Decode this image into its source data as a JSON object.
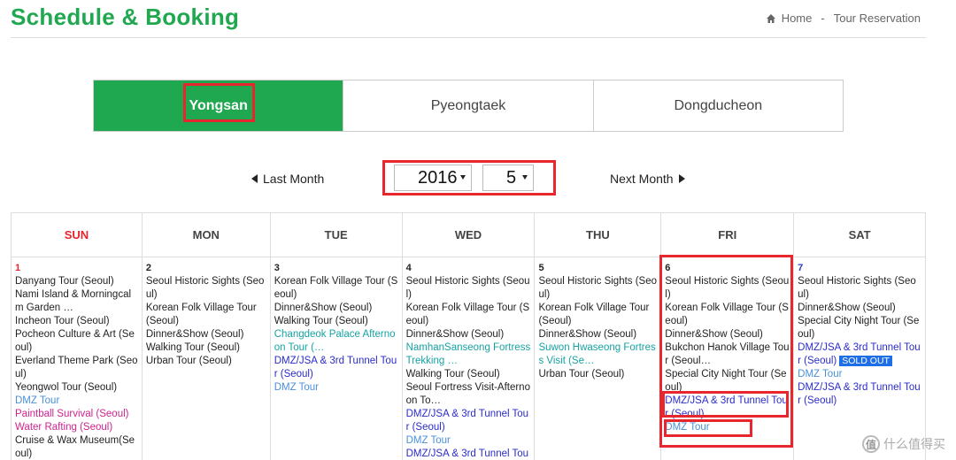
{
  "header": {
    "title": "Schedule & Booking",
    "breadcrumb": {
      "home": "Home",
      "separator": "-",
      "current": "Tour Reservation"
    }
  },
  "locations": [
    {
      "label": "Yongsan",
      "active": true
    },
    {
      "label": "Pyeongtaek",
      "active": false
    },
    {
      "label": "Dongducheon",
      "active": false
    }
  ],
  "month_nav": {
    "prev_label": "Last Month",
    "next_label": "Next Month",
    "year": "2016",
    "month": "5"
  },
  "calendar": {
    "days_of_week": [
      "SUN",
      "MON",
      "TUE",
      "WED",
      "THU",
      "FRI",
      "SAT"
    ],
    "days": [
      {
        "num": "1",
        "tours": [
          {
            "text": "Danyang Tour (Seoul)",
            "color": "black"
          },
          {
            "text": "Nami Island & Morningcalm Garden …",
            "color": "black"
          },
          {
            "text": "Incheon Tour (Seoul)",
            "color": "black"
          },
          {
            "text": "Pocheon Culture & Art (Seoul)",
            "color": "black"
          },
          {
            "text": "Everland Theme Park (Seoul)",
            "color": "black"
          },
          {
            "text": "Yeongwol Tour (Seoul)",
            "color": "black"
          },
          {
            "text": "DMZ Tour",
            "color": "lightblue"
          },
          {
            "text": "Paintball Survival (Seoul)",
            "color": "pink"
          },
          {
            "text": "Water Rafting (Seoul)",
            "color": "pink"
          },
          {
            "text": "Cruise & Wax Museum(Seoul)",
            "color": "black"
          }
        ]
      },
      {
        "num": "2",
        "tours": [
          {
            "text": "Seoul Historic Sights (Seoul)",
            "color": "black"
          },
          {
            "text": "Korean Folk Village Tour (Seoul)",
            "color": "black"
          },
          {
            "text": "Dinner&Show (Seoul)",
            "color": "black"
          },
          {
            "text": "Walking Tour (Seoul)",
            "color": "black"
          },
          {
            "text": "Urban Tour (Seoul)",
            "color": "black"
          }
        ]
      },
      {
        "num": "3",
        "tours": [
          {
            "text": "Korean Folk Village Tour (Seoul)",
            "color": "black"
          },
          {
            "text": "Dinner&Show (Seoul)",
            "color": "black"
          },
          {
            "text": "Walking Tour (Seoul)",
            "color": "black"
          },
          {
            "text": "Changdeok Palace Afternoon Tour (…",
            "color": "teal"
          },
          {
            "text": "DMZ/JSA & 3rd Tunnel Tour (Seoul)",
            "color": "blue"
          },
          {
            "text": "DMZ Tour",
            "color": "lightblue"
          }
        ]
      },
      {
        "num": "4",
        "tours": [
          {
            "text": "Seoul Historic Sights (Seoul)",
            "color": "black"
          },
          {
            "text": "Korean Folk Village Tour (Seoul)",
            "color": "black"
          },
          {
            "text": "Dinner&Show (Seoul)",
            "color": "black"
          },
          {
            "text": "NamhanSanseong Fortress Trekking …",
            "color": "teal"
          },
          {
            "text": "Walking Tour (Seoul)",
            "color": "black"
          },
          {
            "text": "Seoul Fortress Visit-Afternoon To…",
            "color": "black"
          },
          {
            "text": "DMZ/JSA & 3rd Tunnel Tour (Seoul)",
            "color": "blue"
          },
          {
            "text": "DMZ Tour",
            "color": "lightblue"
          },
          {
            "text": "DMZ/JSA & 3rd Tunnel Tou",
            "color": "blue"
          }
        ]
      },
      {
        "num": "5",
        "tours": [
          {
            "text": "Seoul Historic Sights (Seoul)",
            "color": "black"
          },
          {
            "text": "Korean Folk Village Tour (Seoul)",
            "color": "black"
          },
          {
            "text": "Dinner&Show (Seoul)",
            "color": "black"
          },
          {
            "text": "Suwon Hwaseong Fortress Visit (Se…",
            "color": "teal"
          },
          {
            "text": "Urban Tour (Seoul)",
            "color": "black"
          }
        ]
      },
      {
        "num": "6",
        "tours": [
          {
            "text": "Seoul Historic Sights (Seoul)",
            "color": "black"
          },
          {
            "text": "Korean Folk Village Tour (Seoul)",
            "color": "black"
          },
          {
            "text": "Dinner&Show (Seoul)",
            "color": "black"
          },
          {
            "text": "Bukchon Hanok Village Tour (Seoul…",
            "color": "black"
          },
          {
            "text": "Special City Night Tour (Seoul)",
            "color": "black"
          },
          {
            "text": "DMZ/JSA & 3rd Tunnel Tour (Seoul)",
            "color": "blue"
          },
          {
            "text": "DMZ Tour",
            "color": "lightblue"
          }
        ]
      },
      {
        "num": "7",
        "tours": [
          {
            "text": "Seoul Historic Sights (Seoul)",
            "color": "black"
          },
          {
            "text": "Dinner&Show (Seoul)",
            "color": "black"
          },
          {
            "text": "Special City Night Tour (Seoul)",
            "color": "black"
          },
          {
            "text": "DMZ/JSA & 3rd Tunnel Tour (Seoul)",
            "color": "blue",
            "badge": "SOLD OUT"
          },
          {
            "text": "DMZ Tour",
            "color": "lightblue"
          },
          {
            "text": "DMZ/JSA & 3rd Tunnel Tour (Seoul)",
            "color": "blue"
          }
        ]
      }
    ]
  },
  "watermark": {
    "icon_text": "值",
    "text": "什么值得买"
  },
  "colors": {
    "brand_green": "#1fa84f",
    "highlight_red": "#e8262d",
    "sold_out": "#1e6ee8"
  }
}
